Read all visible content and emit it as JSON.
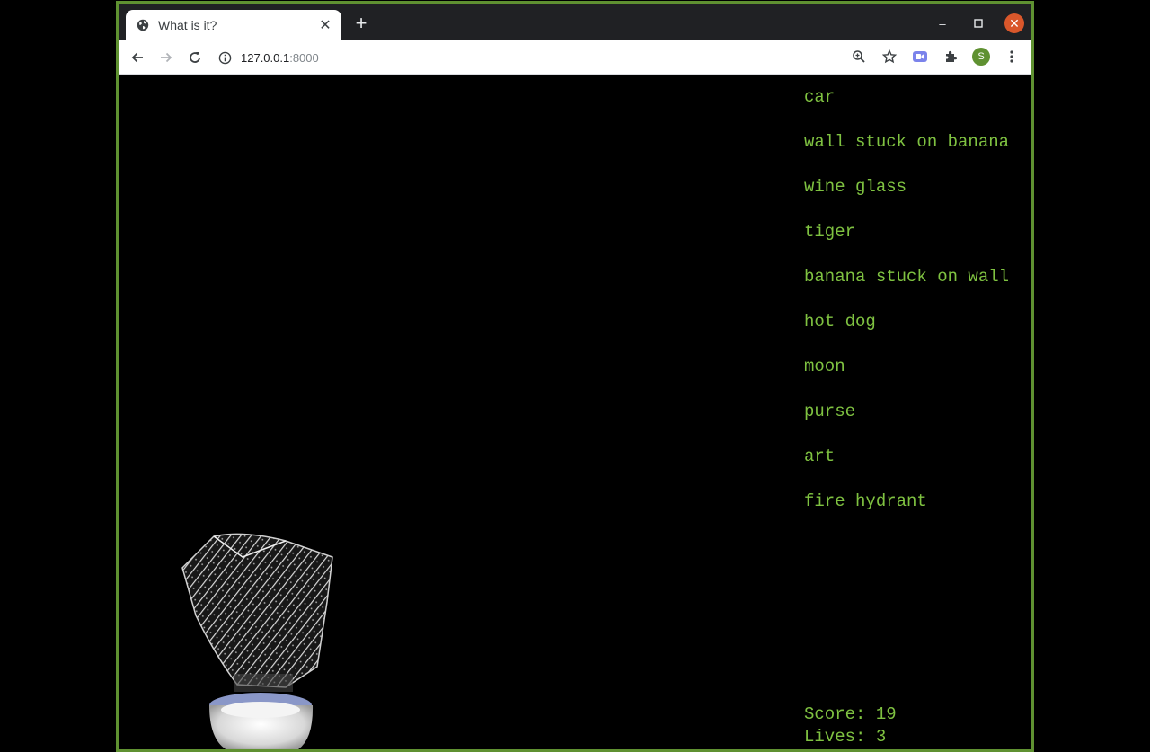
{
  "browser": {
    "tab_title": "What is it?",
    "url_host": "127.0.0.1",
    "url_port": ":8000",
    "profile_initial": "S"
  },
  "icons": {
    "tab_favicon": "globe-icon",
    "tab_close": "close-icon",
    "new_tab": "plus-icon",
    "back": "back-arrow-icon",
    "forward": "forward-arrow-icon",
    "reload": "reload-icon",
    "site_info": "info-icon",
    "zoom": "zoom-icon",
    "bookmark": "star-icon",
    "meet": "video-camera-icon",
    "extensions": "puzzle-icon",
    "menu": "kebab-menu-icon"
  },
  "colors": {
    "accent_green": "#7fc241",
    "window_border": "#5f9131",
    "close_button": "#d9572b"
  },
  "game": {
    "options": [
      "car",
      "wall stuck on banana",
      "wine glass",
      "tiger",
      "banana stuck on wall",
      "hot dog",
      "moon",
      "purse",
      "art",
      "fire hydrant"
    ],
    "score_text": "Score: 19",
    "lives_text": "Lives: 3",
    "object_icon": "sketch-object-image"
  }
}
